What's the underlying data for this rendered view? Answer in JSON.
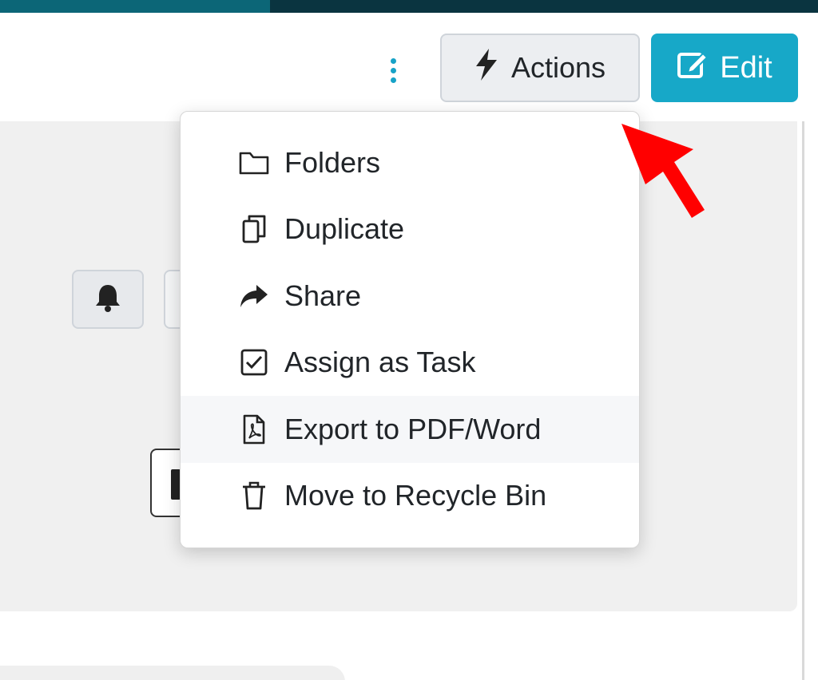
{
  "header": {
    "progress_pct": 33,
    "more_icon": "kebab-vertical-icon",
    "actions": {
      "label": "Actions",
      "icon": "bolt-icon"
    },
    "edit": {
      "label": "Edit",
      "icon": "edit-icon"
    }
  },
  "colors": {
    "accent": "#17a8c8",
    "top_bar": "#0a3440",
    "annotation_arrow": "#ff0000"
  },
  "actions_menu": {
    "items": [
      {
        "label": "Folders",
        "icon": "folder-icon"
      },
      {
        "label": "Duplicate",
        "icon": "copy-icon"
      },
      {
        "label": "Share",
        "icon": "share-icon"
      },
      {
        "label": "Assign as Task",
        "icon": "checkbox-icon"
      },
      {
        "label": "Export to PDF/Word",
        "icon": "pdf-file-icon"
      },
      {
        "label": "Move to Recycle Bin",
        "icon": "trash-icon"
      }
    ],
    "highlighted_index": 4
  }
}
